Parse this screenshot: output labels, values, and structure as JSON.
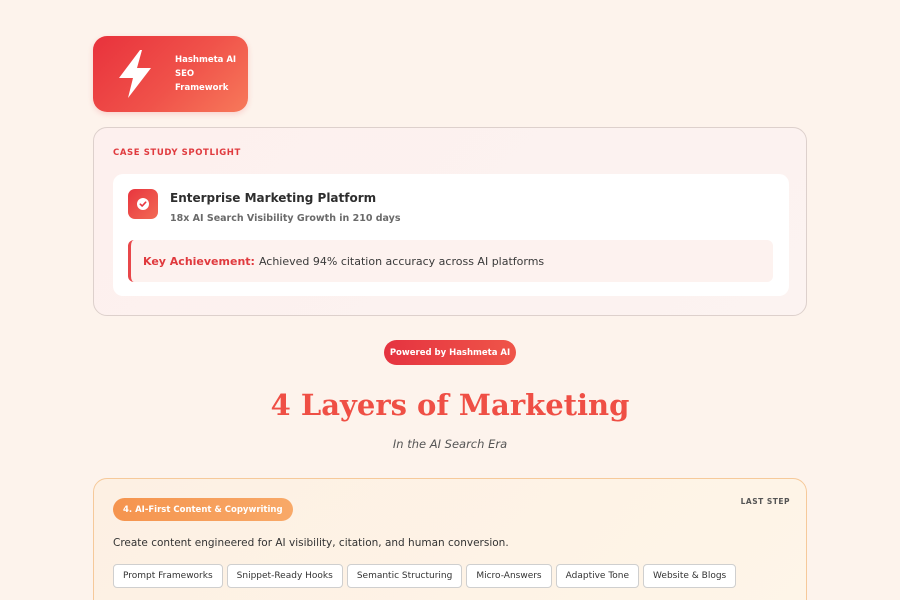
{
  "logo": {
    "icon": "lightning-bolt-icon",
    "lines": [
      "Hashmeta AI",
      "SEO",
      "Framework"
    ]
  },
  "case_study": {
    "label": "CASE STUDY SPOTLIGHT",
    "icon": "check-circle-icon",
    "title": "Enterprise Marketing Platform",
    "subtitle": "18x AI Search Visibility Growth in 210 days",
    "achievement_key": "Key Achievement:",
    "achievement_text": "Achieved 94% citation accuracy across AI platforms"
  },
  "powered_badge": "Powered by Hashmeta AI",
  "heading": {
    "title": "4 Layers of Marketing",
    "subtitle": "In the AI Search Era"
  },
  "layer": {
    "pill": "4. AI-First Content & Copywriting",
    "step": "LAST STEP",
    "description": "Create content engineered for AI visibility, citation, and human conversion.",
    "tags": [
      "Prompt Frameworks",
      "Snippet-Ready Hooks",
      "Semantic Structuring",
      "Micro-Answers",
      "Adaptive Tone",
      "Website & Blogs"
    ]
  },
  "colors": {
    "accent_red": "#e8323c",
    "accent_orange": "#f5944e",
    "background": "#fdf3ec"
  }
}
